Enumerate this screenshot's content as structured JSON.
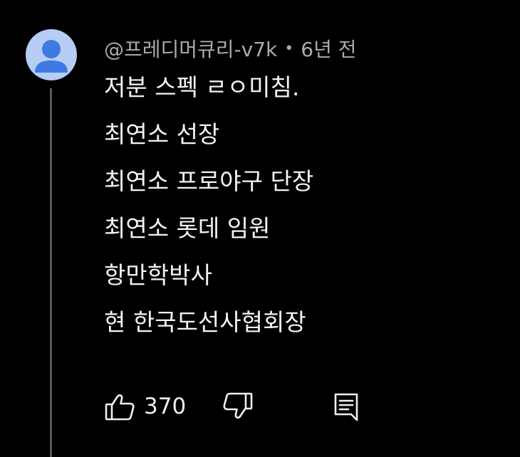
{
  "comment": {
    "author": "@프레디머큐리-v7k",
    "separator": "•",
    "time": "6년 전",
    "lines": [
      "저분 스펙 ㄹㅇ미침.",
      "최연소 선장",
      "최연소 프로야구 단장",
      "최연소 롯데 임원",
      "항만학박사",
      "현 한국도선사협회장"
    ],
    "like_count": "370",
    "avatar_color": "#b6cdf6",
    "avatar_figure_color": "#3f7ae4"
  },
  "actions": {
    "like_icon": "thumbs-up-icon",
    "dislike_icon": "thumbs-down-icon",
    "reply_icon": "comment-reply-icon"
  }
}
